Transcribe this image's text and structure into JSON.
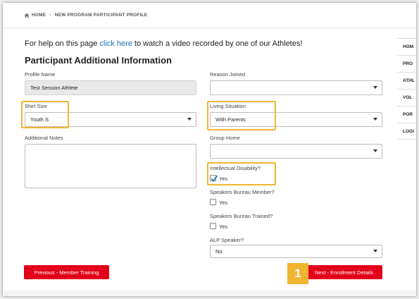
{
  "breadcrumb": {
    "home": "HOME",
    "current": "NEW PROGRAM PARTICIPANT PROFILE"
  },
  "help": {
    "prefix": "For help on this page ",
    "link": "click here",
    "suffix": " to watch a video recorded by one of our Athletes!"
  },
  "section_title": "Participant Additional Information",
  "form": {
    "profile_name": {
      "label": "Profile Name",
      "value": "Test Session Athlete"
    },
    "reason_joined": {
      "label": "Reason Joined",
      "value": ""
    },
    "shirt_size": {
      "label": "Shirt Size",
      "value": "Youth S"
    },
    "living_situation": {
      "label": "Living Situation",
      "value": "With Parents"
    },
    "additional_notes": {
      "label": "Additional Notes",
      "value": ""
    },
    "group_home": {
      "label": "Group Home",
      "value": ""
    },
    "intellectual_disability": {
      "label": "Intellectual Disability?",
      "option": "Yes",
      "checked": true
    },
    "speakers_bureau_member": {
      "label": "Speakers Bureau Member?",
      "option": "Yes",
      "checked": false
    },
    "speakers_bureau_trained": {
      "label": "Speakers Bureau Trained?",
      "option": "Yes",
      "checked": false
    },
    "alp_speaker": {
      "label": "ALP Speaker?",
      "value": "No"
    }
  },
  "buttons": {
    "previous": "Previous - Member Training",
    "next": "Next - Enrollment Details"
  },
  "callout_number": "1",
  "sidenav": [
    "HOM",
    "PRO",
    "ATHL",
    "VOL",
    "POR",
    "LOGI"
  ],
  "colors": {
    "accent_red": "#e3001b",
    "highlight": "#f2b531",
    "link": "#1a73b8"
  }
}
